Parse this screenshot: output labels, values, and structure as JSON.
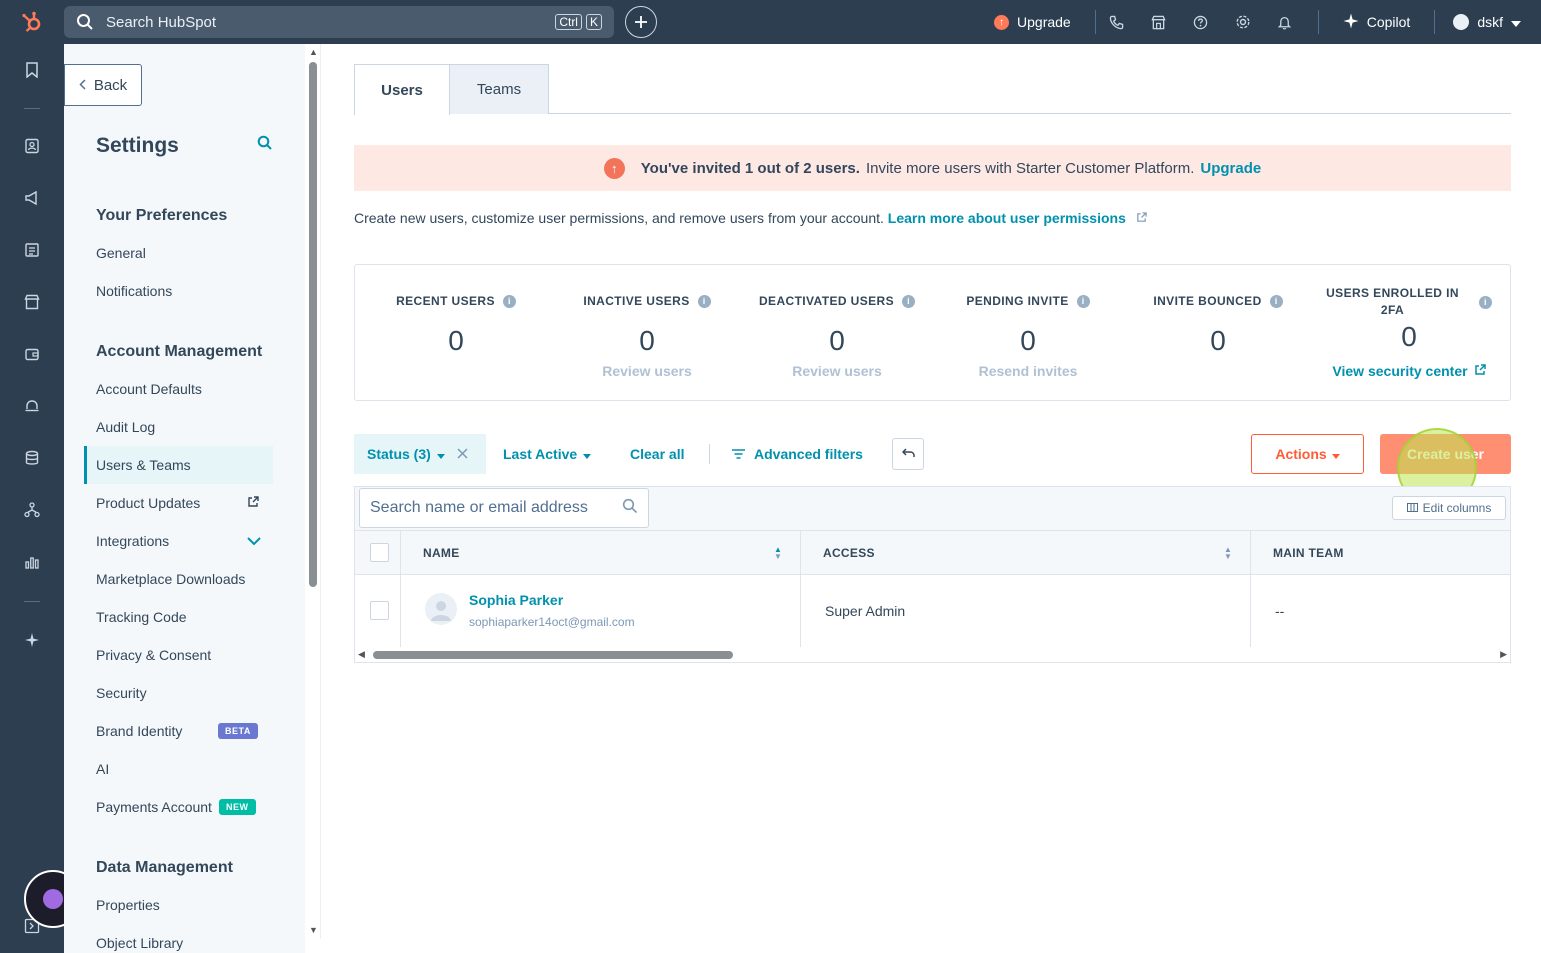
{
  "topnav": {
    "search_placeholder": "Search HubSpot",
    "kbd_ctrl": "Ctrl",
    "kbd_k": "K",
    "upgrade_label": "Upgrade",
    "copilot_label": "Copilot",
    "account_name": "dskf"
  },
  "sidebar": {
    "back_label": "Back",
    "title": "Settings",
    "sections": {
      "preferences": "Your Preferences",
      "account": "Account Management",
      "data": "Data Management"
    },
    "items": {
      "general": "General",
      "notifications": "Notifications",
      "account_defaults": "Account Defaults",
      "audit_log": "Audit Log",
      "users_teams": "Users & Teams",
      "product_updates": "Product Updates",
      "integrations": "Integrations",
      "marketplace_downloads": "Marketplace Downloads",
      "tracking_code": "Tracking Code",
      "privacy_consent": "Privacy & Consent",
      "security": "Security",
      "brand_identity": "Brand Identity",
      "ai": "AI",
      "payments_account": "Payments Account",
      "properties": "Properties",
      "object_library": "Object Library"
    },
    "badges": {
      "beta": "BETA",
      "new": "NEW"
    }
  },
  "tabs": {
    "users": "Users",
    "teams": "Teams"
  },
  "alert": {
    "bold": "You've invited 1 out of 2 users.",
    "text": "Invite more users with Starter Customer Platform.",
    "link": "Upgrade"
  },
  "intro": {
    "text": "Create new users, customize user permissions, and remove users from your account.",
    "link": "Learn more about user permissions"
  },
  "stats": [
    {
      "label": "RECENT USERS",
      "value": "0",
      "sub": ""
    },
    {
      "label": "INACTIVE USERS",
      "value": "0",
      "sub": "Review users"
    },
    {
      "label": "DEACTIVATED USERS",
      "value": "0",
      "sub": "Review users"
    },
    {
      "label": "PENDING INVITE",
      "value": "0",
      "sub": "Resend invites"
    },
    {
      "label": "INVITE BOUNCED",
      "value": "0",
      "sub": ""
    },
    {
      "label_line1": "USERS ENROLLED IN",
      "label_line2": "2FA",
      "value": "0",
      "link": "View security center"
    }
  ],
  "filters": {
    "status": "Status (3)",
    "last_active": "Last Active",
    "clear_all": "Clear all",
    "advanced": "Advanced filters",
    "actions": "Actions",
    "create_user": "Create user"
  },
  "table": {
    "search_placeholder": "Search name or email address",
    "edit_columns": "Edit columns",
    "headers": {
      "name": "NAME",
      "access": "ACCESS",
      "main_team": "MAIN TEAM"
    },
    "rows": [
      {
        "name": "Sophia Parker",
        "email": "sophiaparker14oct@gmail.com",
        "access": "Super Admin",
        "main_team": "--"
      }
    ]
  }
}
